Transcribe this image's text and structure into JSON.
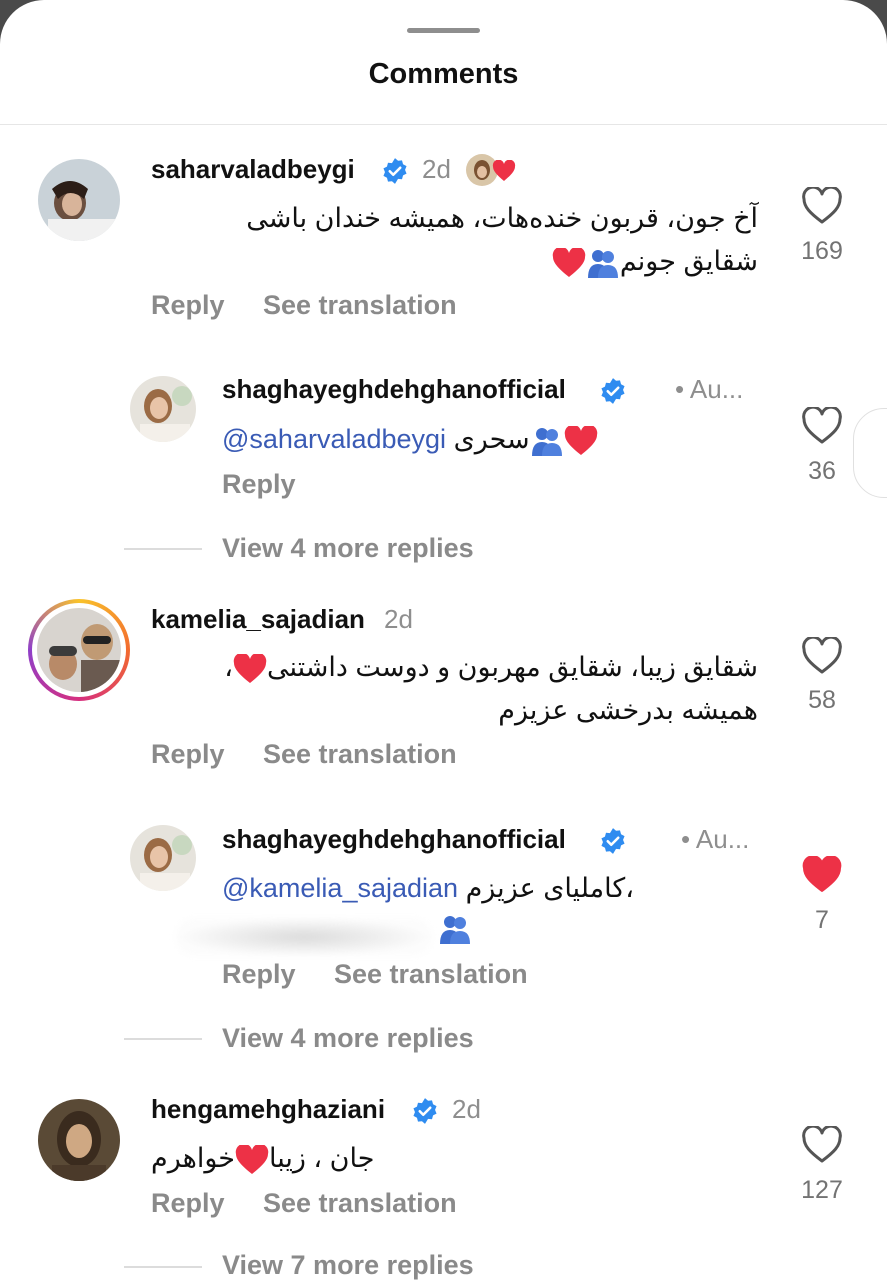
{
  "header": {
    "title": "Comments"
  },
  "comments": [
    {
      "username": "saharvaladbeygi",
      "verified": true,
      "time": "2d",
      "line1": "آخ جون، قربون خنده‌هات، همیشه خندان باشی",
      "line2": "شقایق جونم",
      "likes": "169",
      "reply_label": "Reply",
      "translate_label": "See translation"
    },
    {
      "username": "shaghayeghdehghanofficial",
      "verified": true,
      "time": "• Au...",
      "mention": "@saharvaladbeygi",
      "text": "سحری",
      "likes": "36",
      "reply_label": "Reply"
    },
    {
      "username": "kamelia_sajadian",
      "verified": false,
      "time": "2d",
      "line1": "شقایق زیبا، شقایق مهربون و دوست داشتنی",
      "line2": "همیشه بدرخشی عزیزم",
      "likes": "58",
      "reply_label": "Reply",
      "translate_label": "See translation"
    },
    {
      "username": "shaghayeghdehghanofficial",
      "verified": true,
      "time": "• Au...",
      "mention": "@kamelia_sajadian",
      "text": "کاملیای عزیزم،",
      "likes": "7",
      "liked": true,
      "reply_label": "Reply",
      "translate_label": "See translation"
    },
    {
      "username": "hengamehghaziani",
      "verified": true,
      "time": "2d",
      "text_a": "جان ، زیبا",
      "text_b": "خواهرم",
      "likes": "127",
      "reply_label": "Reply",
      "translate_label": "See translation"
    }
  ],
  "view_more": [
    "View 4 more replies",
    "View 4 more replies",
    "View 7 more replies"
  ],
  "colors": {
    "verified": "#2f8cf0",
    "heart_red": "#ed3146",
    "mention": "#3a5bb5",
    "muted": "#8a8a8a"
  },
  "icons": {
    "like": "heart-outline-icon",
    "liked": "heart-filled-icon",
    "verified": "verified-badge-icon"
  }
}
